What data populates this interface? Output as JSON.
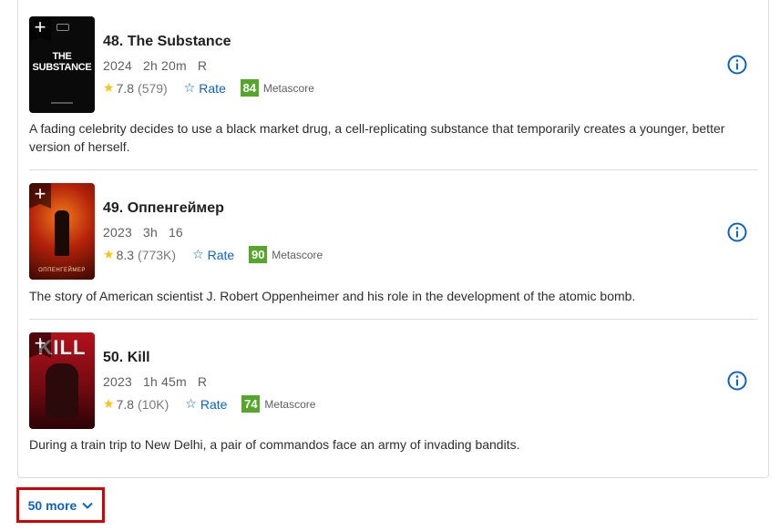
{
  "items": [
    {
      "title": "48. The Substance",
      "year": "2024",
      "runtime": "2h 20m",
      "certificate": "R",
      "rating": "7.8",
      "votes": "(579)",
      "rate_label": "Rate",
      "metascore": "84",
      "metascore_label": "Metascore",
      "poster_text": "THE SUBSTANCE",
      "description": "A fading celebrity decides to use a black market drug, a cell-replicating substance that temporarily creates a younger, better version of herself."
    },
    {
      "title": "49. Оппенгеймер",
      "year": "2023",
      "runtime": "3h",
      "certificate": "16",
      "rating": "8.3",
      "votes": "(773K)",
      "rate_label": "Rate",
      "metascore": "90",
      "metascore_label": "Metascore",
      "poster_text": "ОППЕНГЕЙМЕР",
      "description": "The story of American scientist J. Robert Oppenheimer and his role in the development of the atomic bomb."
    },
    {
      "title": "50. Kill",
      "year": "2023",
      "runtime": "1h 45m",
      "certificate": "R",
      "rating": "7.8",
      "votes": "(10K)",
      "rate_label": "Rate",
      "metascore": "74",
      "metascore_label": "Metascore",
      "poster_text": "KILL",
      "description": "During a train trip to New Delhi, a pair of commandos face an army of invading bandits."
    }
  ],
  "more_button": {
    "label": "50 more"
  },
  "colors": {
    "accent": "#0e63be",
    "metascore": "#54a72a",
    "star": "#f5c518",
    "highlight": "#d40000"
  }
}
